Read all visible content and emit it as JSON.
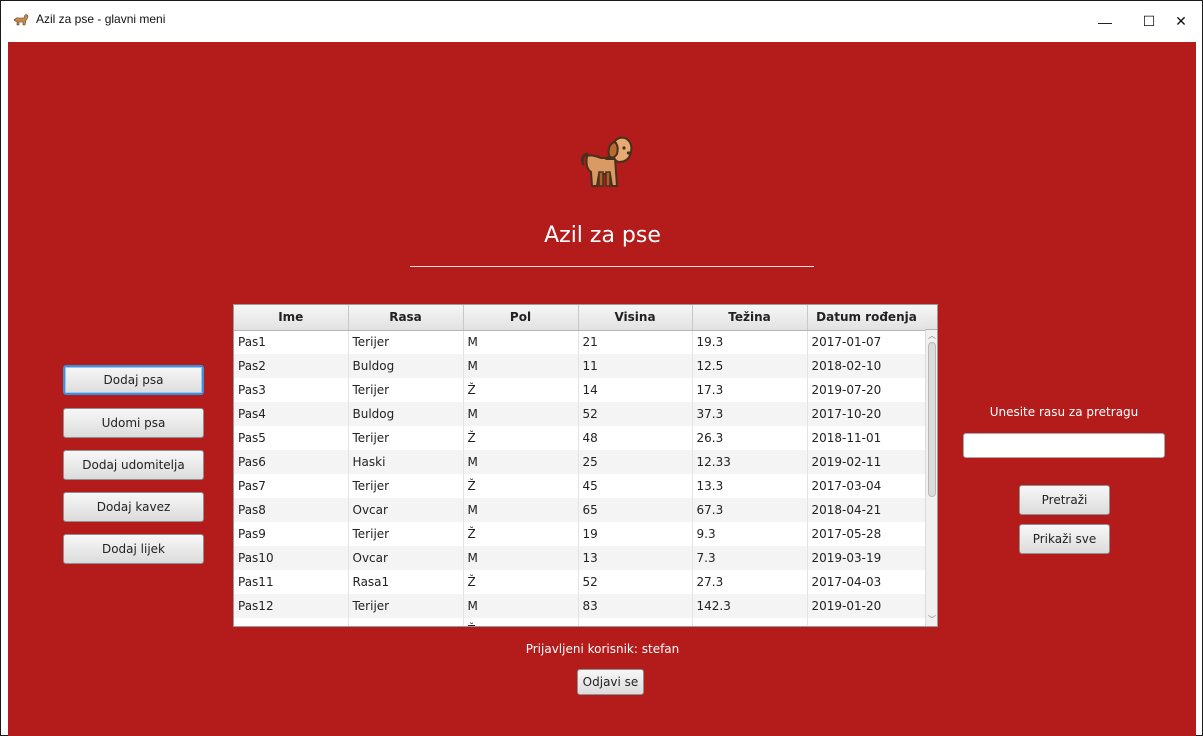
{
  "window": {
    "title": "Azil za pse - glavni meni",
    "minimize": "—",
    "maximize": "☐",
    "close": "✕"
  },
  "header": {
    "app_title": "Azil za pse",
    "logo_icon": "dog-icon"
  },
  "left_menu": {
    "items": [
      {
        "label": "Dodaj psa"
      },
      {
        "label": "Udomi psa"
      },
      {
        "label": "Dodaj udomitelja"
      },
      {
        "label": "Dodaj kavez"
      },
      {
        "label": "Dodaj lijek"
      }
    ]
  },
  "table": {
    "columns": [
      "Ime",
      "Rasa",
      "Pol",
      "Visina",
      "Težina",
      "Datum rođenja"
    ],
    "rows": [
      [
        "Pas1",
        "Terijer",
        "M",
        "21",
        "19.3",
        "2017-01-07"
      ],
      [
        "Pas2",
        "Buldog",
        "M",
        "11",
        "12.5",
        "2018-02-10"
      ],
      [
        "Pas3",
        "Terijer",
        "Ž",
        "14",
        "17.3",
        "2019-07-20"
      ],
      [
        "Pas4",
        "Buldog",
        "M",
        "52",
        "37.3",
        "2017-10-20"
      ],
      [
        "Pas5",
        "Terijer",
        "Ž",
        "48",
        "26.3",
        "2018-11-01"
      ],
      [
        "Pas6",
        "Haski",
        "M",
        "25",
        "12.33",
        "2019-02-11"
      ],
      [
        "Pas7",
        "Terijer",
        "Ž",
        "45",
        "13.3",
        "2017-03-04"
      ],
      [
        "Pas8",
        "Ovcar",
        "M",
        "65",
        "67.3",
        "2018-04-21"
      ],
      [
        "Pas9",
        "Terijer",
        "Ž",
        "19",
        "9.3",
        "2017-05-28"
      ],
      [
        "Pas10",
        "Ovcar",
        "M",
        "13",
        "7.3",
        "2019-03-19"
      ],
      [
        "Pas11",
        "Rasa1",
        "Ž",
        "52",
        "27.3",
        "2017-04-03"
      ],
      [
        "Pas12",
        "Terijer",
        "M",
        "83",
        "142.3",
        "2019-01-20"
      ],
      [
        "",
        "",
        "Ž",
        "",
        "",
        ""
      ]
    ]
  },
  "search": {
    "label": "Unesite rasu za pretragu",
    "value": "",
    "search_button": "Pretraži",
    "show_all_button": "Prikaži sve"
  },
  "footer": {
    "user_label": "Prijavljeni korisnik: stefan",
    "logout_button": "Odjavi se"
  },
  "colors": {
    "background": "#b41c1c",
    "focus": "#3c8fd8"
  }
}
